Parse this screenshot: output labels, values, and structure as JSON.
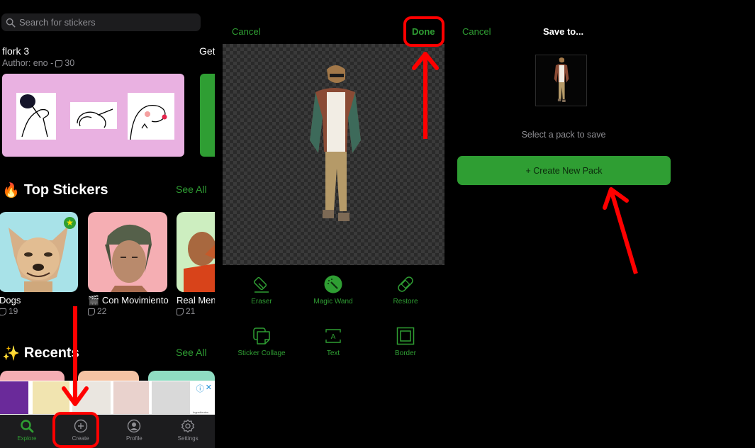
{
  "explore": {
    "search": {
      "placeholder": "Search for stickers",
      "icon": "search-icon"
    },
    "featured_pack": {
      "title": "flork 3",
      "author_label": "Author: eno -",
      "sticker_count": "30",
      "get_label": "Get",
      "card_color": "#e9b1e1"
    },
    "top_stickers": {
      "title": "Top Stickers",
      "emoji": "🔥",
      "see_all": "See All",
      "items": [
        {
          "name": "Dogs",
          "count": "19",
          "bg": "#a8e2e8",
          "badge": "★"
        },
        {
          "name": "Con Movimiento",
          "prefix_emoji": "🎬",
          "count": "22",
          "bg": "#f5aeb3"
        },
        {
          "name": "Real Men",
          "count": "21",
          "bg": "#cdeec0"
        }
      ]
    },
    "recents": {
      "title": "Recents",
      "emoji": "✨",
      "see_all": "See All",
      "card_colors": [
        "#f5aeb3",
        "#f5c3a3",
        "#8fdcc2"
      ]
    },
    "ad": {
      "info_icon": "ⓘ",
      "close_icon": "✕",
      "caption": "Ingredientes"
    },
    "tabbar": [
      {
        "label": "Explore",
        "icon": "search-icon",
        "active": true
      },
      {
        "label": "Create",
        "icon": "plus-circle-icon",
        "active": false
      },
      {
        "label": "Profile",
        "icon": "person-icon",
        "active": false
      },
      {
        "label": "Settings",
        "icon": "gear-icon",
        "active": false
      }
    ]
  },
  "editor": {
    "cancel_label": "Cancel",
    "done_label": "Done",
    "tools": [
      {
        "label": "Eraser",
        "icon": "eraser-icon"
      },
      {
        "label": "Magic Wand",
        "icon": "magic-wand-icon",
        "active": true
      },
      {
        "label": "Restore",
        "icon": "bandage-icon"
      },
      {
        "label": "Sticker Collage",
        "icon": "collage-icon"
      },
      {
        "label": "Text",
        "icon": "text-icon"
      },
      {
        "label": "Border",
        "icon": "border-icon"
      }
    ]
  },
  "save": {
    "cancel_label": "Cancel",
    "title": "Save to...",
    "prompt": "Select a pack to save",
    "create_button": "+ Create New Pack"
  },
  "colors": {
    "accent": "#2f9e33",
    "annotation": "#ff0000",
    "secondary_text": "#8e8e93"
  }
}
